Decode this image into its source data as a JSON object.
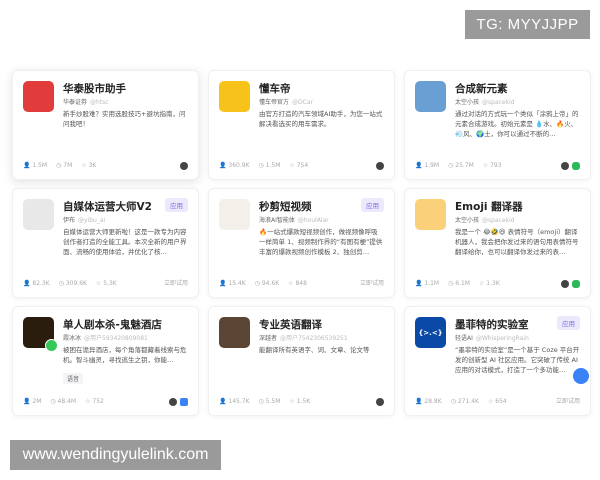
{
  "watermarks": {
    "tg": "TG: MYYJJPP",
    "url": "www.wendingyulelink.com"
  },
  "cards": [
    {
      "title": "华泰股市助手",
      "author": "华泰证券",
      "handle": "@htsc",
      "desc": "新手炒股难？实用选股技巧+避坑指南，问问我吧！",
      "users": "1.5M",
      "chats": "7M",
      "favs": "3K",
      "avatar_color": "#e23b3b",
      "badge": "",
      "action": "",
      "icons": [
        "avatar-icon"
      ]
    },
    {
      "title": "懂车帝",
      "author": "懂车帝官方",
      "handle": "@DCar",
      "desc": "由官方打造的汽车领域AI助手，为您一站式解决看选买的用车需求。",
      "users": "360.9K",
      "chats": "1.5M",
      "favs": "754",
      "avatar_color": "#f7c21a",
      "badge": "",
      "action": "",
      "icons": [
        "avatar-icon"
      ]
    },
    {
      "title": "合成新元素",
      "author": "太空小孩",
      "handle": "@spacekid",
      "desc": "通过对话的方式玩一个类似「涂鸦上帝」的元素合成游戏。初始元素是 💧水、🔥火、💨风、🌍土，你可以通过不断的…",
      "users": "1.9M",
      "chats": "25.7M",
      "favs": "793",
      "avatar_color": "#6a9fd4",
      "badge": "",
      "action": "",
      "icons": [
        "avatar-icon",
        "wechat-icon"
      ]
    },
    {
      "title": "自媒体运营大师V2",
      "author": "伊布",
      "handle": "@yibu_ai",
      "desc": "自媒体运营大师更新啦！这是一款专为内容创作者打造的全能工具。本次全新的用户界面、流畅的使用体验，并优化了核…",
      "users": "82.3K",
      "chats": "309.6K",
      "favs": "5.3K",
      "avatar_color": "#e8e8e8",
      "badge": "应用",
      "action": "立即试用",
      "icons": []
    },
    {
      "title": "秒剪短视频",
      "author": "海浪AI智能体",
      "handle": "@houlAlar",
      "desc": "🔥一站式爆款短视频创作，做视频像呼吸一样简单 1、视频制作界的“有图有梗”提供丰富的爆款视频创作模板 2、独创剪…",
      "users": "15.4K",
      "chats": "94.6K",
      "favs": "848",
      "avatar_color": "#f3efe9",
      "badge": "应用",
      "action": "立即试用",
      "icons": []
    },
    {
      "title": "Emoji 翻译器",
      "author": "太空小孩",
      "handle": "@spacekid",
      "desc": "我是一个 😂🤣😆 表情符号（emoji）翻译机器人，我会把你发过来的语句用表情符号翻译给你，也可以翻译你发过来的表…",
      "users": "1.1M",
      "chats": "6.1M",
      "favs": "1.3K",
      "avatar_color": "#fbd07a",
      "badge": "",
      "action": "",
      "icons": [
        "avatar-icon",
        "wechat-icon"
      ]
    },
    {
      "title": "单人剧本杀-鬼魅酒店",
      "author": "霞冰冰",
      "handle": "@用户593420809081",
      "desc": "被困在诡异酒店，每个角落都藏着线索与危机。智斗幽灵，寻找逃生之钥，你能…",
      "tag": "语音",
      "users": "2M",
      "chats": "48.4M",
      "favs": "752",
      "avatar_color": "#2a1d0e",
      "badge": "",
      "action": "",
      "icons": [
        "avatar-icon",
        "doubao-icon"
      ]
    },
    {
      "title": "专业英语翻译",
      "author": "深越者",
      "handle": "@用户7542306539251",
      "desc": "能翻译所有英语字、词、文章、论文等",
      "users": "145.7K",
      "chats": "5.5M",
      "favs": "1.5K",
      "avatar_color": "#5b4636",
      "badge": "",
      "action": "",
      "icons": [
        "avatar-icon"
      ]
    },
    {
      "title": "墨菲特的实验室",
      "author": "轻语AI",
      "handle": "@WhisperingRain",
      "desc": "“墨菲特的实验室”是一个基于 Coze 平台开发的创新型 AI 社区应用。它突破了传统 AI 应用的对话模式，打造了一个多功能…",
      "users": "28.8K",
      "chats": "271.4K",
      "favs": "654",
      "avatar_color": "#0a4aa6",
      "avatar_text": "{>.<}",
      "badge": "应用",
      "action": "立即试用",
      "icons": []
    }
  ]
}
